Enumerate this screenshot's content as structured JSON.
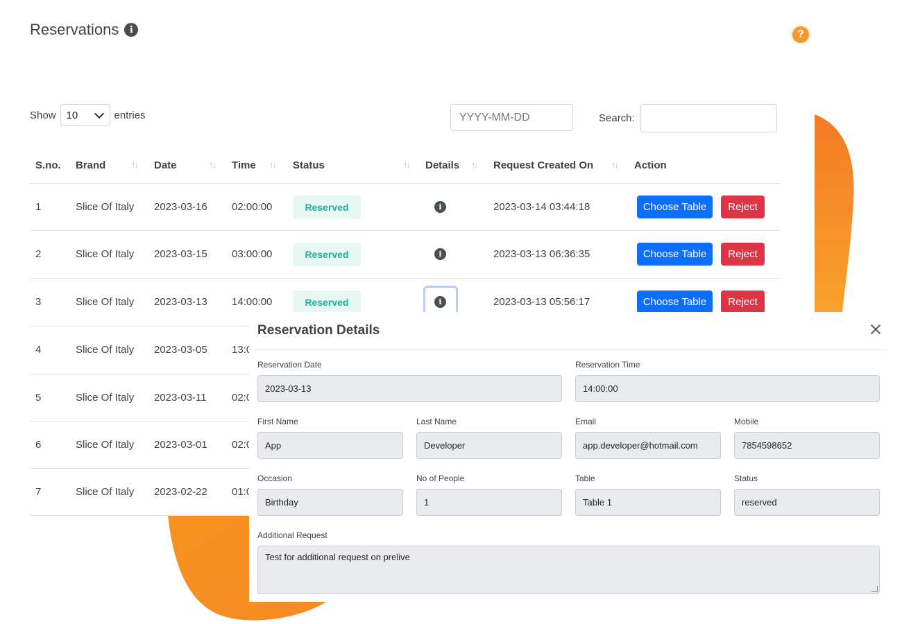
{
  "page": {
    "title": "Reservations"
  },
  "controls": {
    "show_label": "Show",
    "entries_value": "10",
    "entries_label": "entries",
    "date_placeholder": "YYYY-MM-DD",
    "search_label": "Search:",
    "search_value": ""
  },
  "table": {
    "headers": {
      "sno": "S.no.",
      "brand": "Brand",
      "date": "Date",
      "time": "Time",
      "status": "Status",
      "details": "Details",
      "created": "Request Created On",
      "action": "Action"
    },
    "sort_glyph": "↑↓",
    "rows": [
      {
        "sno": "1",
        "brand": "Slice Of Italy",
        "date": "2023-03-16",
        "time": "02:00:00",
        "status": "Reserved",
        "created": "2023-03-14 03:44:18",
        "choose": "Choose Table",
        "reject": "Reject"
      },
      {
        "sno": "2",
        "brand": "Slice Of Italy",
        "date": "2023-03-15",
        "time": "03:00:00",
        "status": "Reserved",
        "created": "2023-03-13 06:36:35",
        "choose": "Choose Table",
        "reject": "Reject"
      },
      {
        "sno": "3",
        "brand": "Slice Of Italy",
        "date": "2023-03-13",
        "time": "14:00:00",
        "status": "Reserved",
        "created": "2023-03-13 05:56:17",
        "choose": "Choose Table",
        "reject": "Reject"
      },
      {
        "sno": "4",
        "brand": "Slice Of Italy",
        "date": "2023-03-05",
        "time": "13:0"
      },
      {
        "sno": "5",
        "brand": "Slice Of Italy",
        "date": "2023-03-11",
        "time": "02:0"
      },
      {
        "sno": "6",
        "brand": "Slice Of Italy",
        "date": "2023-03-01",
        "time": "02:0"
      },
      {
        "sno": "7",
        "brand": "Slice Of Italy",
        "date": "2023-02-22",
        "time": "01:0"
      }
    ]
  },
  "modal": {
    "title": "Reservation Details",
    "fields": {
      "reservation_date": {
        "label": "Reservation Date",
        "value": "2023-03-13"
      },
      "reservation_time": {
        "label": "Reservation Time",
        "value": "14:00:00"
      },
      "first_name": {
        "label": "First Name",
        "value": "App"
      },
      "last_name": {
        "label": "Last Name",
        "value": "Developer"
      },
      "email": {
        "label": "Email",
        "value": "app.developer@hotmail.com"
      },
      "mobile": {
        "label": "Mobile",
        "value": "7854598652"
      },
      "occasion": {
        "label": "Occasion",
        "value": "Birthday"
      },
      "people": {
        "label": "No of People",
        "value": "1"
      },
      "table": {
        "label": "Table",
        "value": "Table 1"
      },
      "status": {
        "label": "Status",
        "value": "reserved"
      },
      "additional_request": {
        "label": "Additional Request",
        "value": "Test for additional request on prelive"
      }
    }
  },
  "icons": {
    "info": "i",
    "help": "?"
  },
  "colors": {
    "primary": "#0d6efd",
    "danger": "#dc3545",
    "success_text": "#1ab394",
    "success_bg": "#e6f7f4",
    "accent_orange": "#f7931e"
  }
}
